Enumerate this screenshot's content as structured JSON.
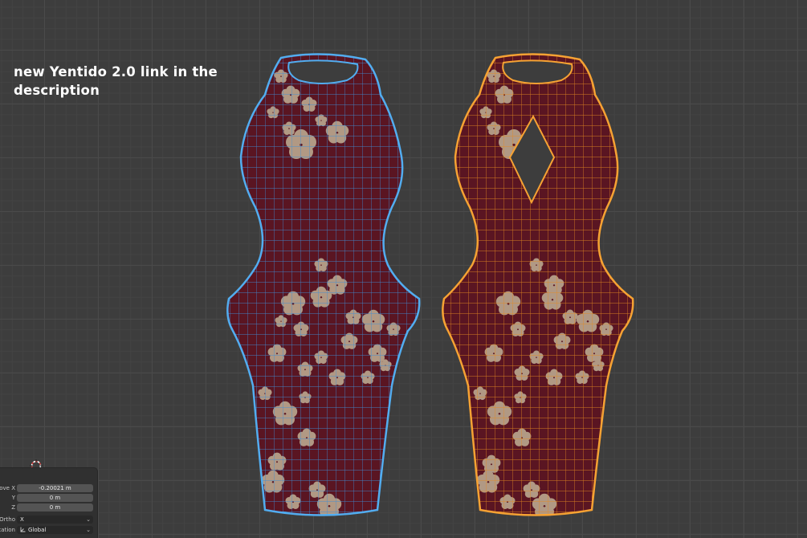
{
  "overlay": {
    "line1": "new Yentido 2.0 link in the",
    "line2": "description"
  },
  "objects": [
    {
      "name": "dress-left",
      "state": "selected",
      "outline_color": "#4aa3e8"
    },
    {
      "name": "dress-right",
      "state": "active",
      "outline_color": "#f39a2a"
    }
  ],
  "colors": {
    "fabric": "#5a1522",
    "blossom": "#b9a58e",
    "grid_bg": "#3d3d3d"
  },
  "operator_panel": {
    "rows": [
      {
        "label": "Move X",
        "value": "-0.20021 m"
      },
      {
        "label": "Y",
        "value": "0 m"
      },
      {
        "label": "Z",
        "value": "0 m"
      }
    ],
    "orientation_label": "Orientation",
    "ortho_label": "Ortho",
    "ortho_value": "X",
    "orientation_value": "Global"
  }
}
